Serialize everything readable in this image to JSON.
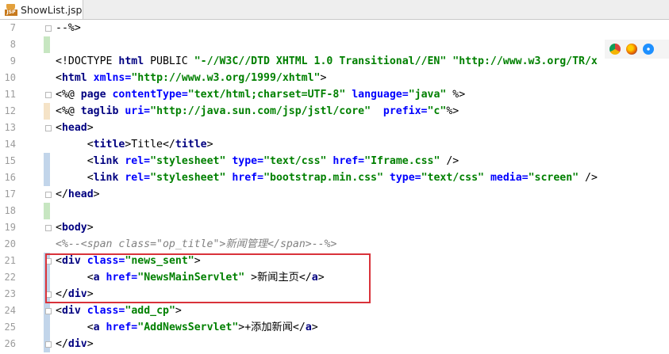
{
  "tab": {
    "label": "ShowList.jsp",
    "icon": "jsp-file-icon",
    "icon_text": "JSP"
  },
  "browsers": [
    "chrome-icon",
    "firefox-icon",
    "safari-icon"
  ],
  "colors": {
    "tag": "#000080",
    "attr": "#0000ff",
    "value": "#008000",
    "comment": "#808080",
    "highlight": "#d9323a"
  },
  "lines": [
    {
      "n": "7",
      "mark": "",
      "tokens": [
        {
          "c": "p",
          "t": "--%>"
        }
      ]
    },
    {
      "n": "8",
      "mark": "green",
      "tokens": []
    },
    {
      "n": "9",
      "mark": "",
      "tokens": [
        {
          "c": "p",
          "t": "<!DOCTYPE "
        },
        {
          "c": "t",
          "t": "html"
        },
        {
          "c": "p",
          "t": " PUBLIC "
        },
        {
          "c": "v",
          "t": "\"-//W3C//DTD XHTML 1.0 Transitional//EN\""
        },
        {
          "c": "p",
          "t": " "
        },
        {
          "c": "v",
          "t": "\"http://www.w3.org/TR/x"
        }
      ]
    },
    {
      "n": "10",
      "mark": "",
      "tokens": [
        {
          "c": "p",
          "t": "<"
        },
        {
          "c": "t",
          "t": "html"
        },
        {
          "c": "p",
          "t": " "
        },
        {
          "c": "a",
          "t": "xmlns="
        },
        {
          "c": "v",
          "t": "\"http://www.w3.org/1999/xhtml\""
        },
        {
          "c": "p",
          "t": ">"
        }
      ]
    },
    {
      "n": "11",
      "mark": "",
      "tokens": [
        {
          "c": "p",
          "t": "<%@ "
        },
        {
          "c": "t",
          "t": "page"
        },
        {
          "c": "p",
          "t": " "
        },
        {
          "c": "a",
          "t": "contentType="
        },
        {
          "c": "v",
          "t": "\"text/html;charset=UTF-8\""
        },
        {
          "c": "p",
          "t": " "
        },
        {
          "c": "a",
          "t": "language="
        },
        {
          "c": "v",
          "t": "\"java\""
        },
        {
          "c": "p",
          "t": " %>"
        }
      ]
    },
    {
      "n": "12",
      "mark": "orange",
      "tokens": [
        {
          "c": "p",
          "t": "<%@ "
        },
        {
          "c": "t",
          "t": "taglib"
        },
        {
          "c": "p",
          "t": " "
        },
        {
          "c": "a",
          "t": "uri="
        },
        {
          "c": "v",
          "t": "\"http://java.sun.com/jsp/jstl/core\""
        },
        {
          "c": "p",
          "t": "  "
        },
        {
          "c": "a",
          "t": "prefix="
        },
        {
          "c": "v",
          "t": "\"c\""
        },
        {
          "c": "p",
          "t": "%>"
        }
      ]
    },
    {
      "n": "13",
      "mark": "",
      "tokens": [
        {
          "c": "p",
          "t": "<"
        },
        {
          "c": "t",
          "t": "head"
        },
        {
          "c": "p",
          "t": ">"
        }
      ]
    },
    {
      "n": "14",
      "mark": "",
      "tokens": [
        {
          "c": "p",
          "t": "     <"
        },
        {
          "c": "t",
          "t": "title"
        },
        {
          "c": "p",
          "t": ">Title</"
        },
        {
          "c": "t",
          "t": "title"
        },
        {
          "c": "p",
          "t": ">"
        }
      ]
    },
    {
      "n": "15",
      "mark": "blue",
      "tokens": [
        {
          "c": "p",
          "t": "     <"
        },
        {
          "c": "t",
          "t": "link"
        },
        {
          "c": "p",
          "t": " "
        },
        {
          "c": "a",
          "t": "rel="
        },
        {
          "c": "v",
          "t": "\"stylesheet\""
        },
        {
          "c": "p",
          "t": " "
        },
        {
          "c": "a",
          "t": "type="
        },
        {
          "c": "v",
          "t": "\"text/css\""
        },
        {
          "c": "p",
          "t": " "
        },
        {
          "c": "a",
          "t": "href="
        },
        {
          "c": "v",
          "t": "\"Iframe.css\""
        },
        {
          "c": "p",
          "t": " />"
        }
      ]
    },
    {
      "n": "16",
      "mark": "blue",
      "tokens": [
        {
          "c": "p",
          "t": "     <"
        },
        {
          "c": "t",
          "t": "link"
        },
        {
          "c": "p",
          "t": " "
        },
        {
          "c": "a",
          "t": "rel="
        },
        {
          "c": "v",
          "t": "\"stylesheet\""
        },
        {
          "c": "p",
          "t": " "
        },
        {
          "c": "a",
          "t": "href="
        },
        {
          "c": "v",
          "t": "\"bootstrap.min.css\""
        },
        {
          "c": "p",
          "t": " "
        },
        {
          "c": "a",
          "t": "type="
        },
        {
          "c": "v",
          "t": "\"text/css\""
        },
        {
          "c": "p",
          "t": " "
        },
        {
          "c": "a",
          "t": "media="
        },
        {
          "c": "v",
          "t": "\"screen\""
        },
        {
          "c": "p",
          "t": " />"
        }
      ]
    },
    {
      "n": "17",
      "mark": "",
      "tokens": [
        {
          "c": "p",
          "t": "</"
        },
        {
          "c": "t",
          "t": "head"
        },
        {
          "c": "p",
          "t": ">"
        }
      ]
    },
    {
      "n": "18",
      "mark": "green",
      "tokens": []
    },
    {
      "n": "19",
      "mark": "",
      "tokens": [
        {
          "c": "p",
          "t": "<"
        },
        {
          "c": "t",
          "t": "body"
        },
        {
          "c": "p",
          "t": ">"
        }
      ]
    },
    {
      "n": "20",
      "mark": "",
      "tokens": [
        {
          "c": "c",
          "t": "<%--<span class=\"op_title\">新闻管理</span>--%>"
        }
      ]
    },
    {
      "n": "21",
      "mark": "blue",
      "tokens": [
        {
          "c": "p",
          "t": "<"
        },
        {
          "c": "t",
          "t": "div"
        },
        {
          "c": "p",
          "t": " "
        },
        {
          "c": "a",
          "t": "class="
        },
        {
          "c": "v",
          "t": "\"news_sent\""
        },
        {
          "c": "p",
          "t": ">"
        }
      ]
    },
    {
      "n": "22",
      "mark": "blue",
      "tokens": [
        {
          "c": "p",
          "t": "     <"
        },
        {
          "c": "t",
          "t": "a"
        },
        {
          "c": "p",
          "t": " "
        },
        {
          "c": "a",
          "t": "href="
        },
        {
          "c": "v",
          "t": "\"NewsMainServlet\""
        },
        {
          "c": "p",
          "t": " >新闻主页</"
        },
        {
          "c": "t",
          "t": "a"
        },
        {
          "c": "p",
          "t": ">"
        }
      ]
    },
    {
      "n": "23",
      "mark": "blue",
      "tokens": [
        {
          "c": "p",
          "t": "</"
        },
        {
          "c": "t",
          "t": "div"
        },
        {
          "c": "p",
          "t": ">"
        }
      ]
    },
    {
      "n": "24",
      "mark": "blue",
      "tokens": [
        {
          "c": "p",
          "t": "<"
        },
        {
          "c": "t",
          "t": "div"
        },
        {
          "c": "p",
          "t": " "
        },
        {
          "c": "a",
          "t": "class="
        },
        {
          "c": "v",
          "t": "\"add_cp\""
        },
        {
          "c": "p",
          "t": ">"
        }
      ]
    },
    {
      "n": "25",
      "mark": "blue",
      "tokens": [
        {
          "c": "p",
          "t": "     <"
        },
        {
          "c": "t",
          "t": "a"
        },
        {
          "c": "p",
          "t": " "
        },
        {
          "c": "a",
          "t": "href="
        },
        {
          "c": "v",
          "t": "\"AddNewsServlet\""
        },
        {
          "c": "p",
          "t": ">+添加新闻</"
        },
        {
          "c": "t",
          "t": "a"
        },
        {
          "c": "p",
          "t": ">"
        }
      ]
    },
    {
      "n": "26",
      "mark": "blue",
      "tokens": [
        {
          "c": "p",
          "t": "</"
        },
        {
          "c": "t",
          "t": "div"
        },
        {
          "c": "p",
          "t": ">"
        }
      ]
    }
  ]
}
